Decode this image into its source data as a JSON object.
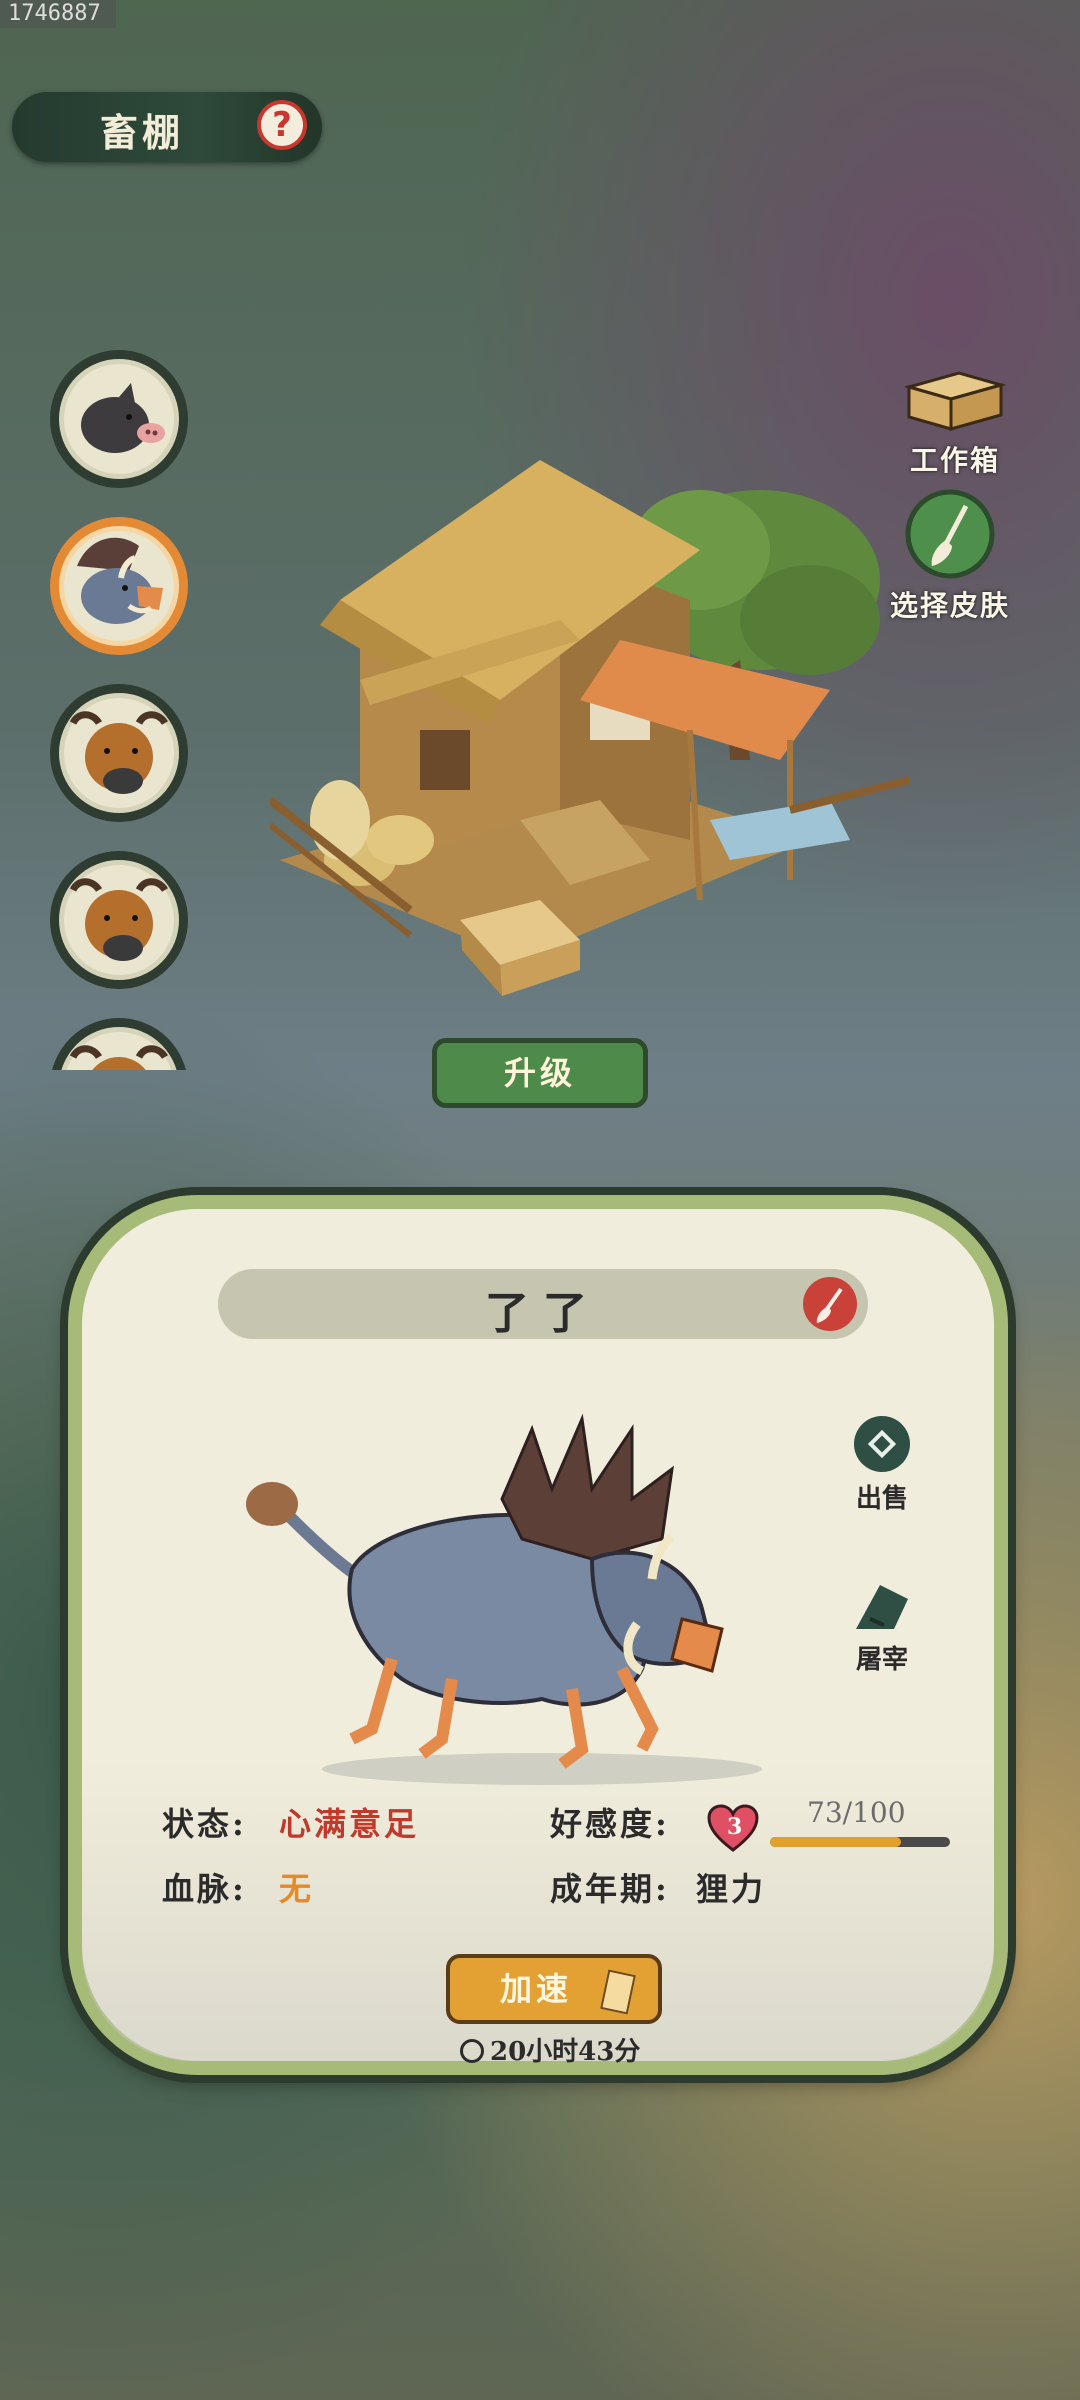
{
  "id_tag": "1746887",
  "header": {
    "title": "畜棚",
    "help_icon": "question-mark"
  },
  "animals": [
    {
      "name": "pig",
      "selected": false
    },
    {
      "name": "boar",
      "selected": true
    },
    {
      "name": "ox",
      "selected": false
    },
    {
      "name": "ox",
      "selected": false
    },
    {
      "name": "ox",
      "selected": false
    }
  ],
  "side_buttons": {
    "toolbox": "工作箱",
    "skin": "选择皮肤"
  },
  "upgrade_label": "升级",
  "detail": {
    "name": "了了",
    "actions": {
      "sell": "出售",
      "slaughter": "屠宰"
    },
    "status_label": "状态:",
    "status_value": "心满意足",
    "bloodline_label": "血脉:",
    "bloodline_value": "无",
    "affection_label": "好感度:",
    "affection_level": "3",
    "affection_value": "73/100",
    "affection_fraction": 0.73,
    "adult_label": "成年期:",
    "adult_value": "狸力",
    "speed_label": "加速",
    "timer": "20小时43分"
  },
  "colors": {
    "accent_green": "#4e8b4a",
    "accent_orange": "#e3a033",
    "status_red": "#c0392b",
    "panel_bg": "#f1eddc"
  }
}
